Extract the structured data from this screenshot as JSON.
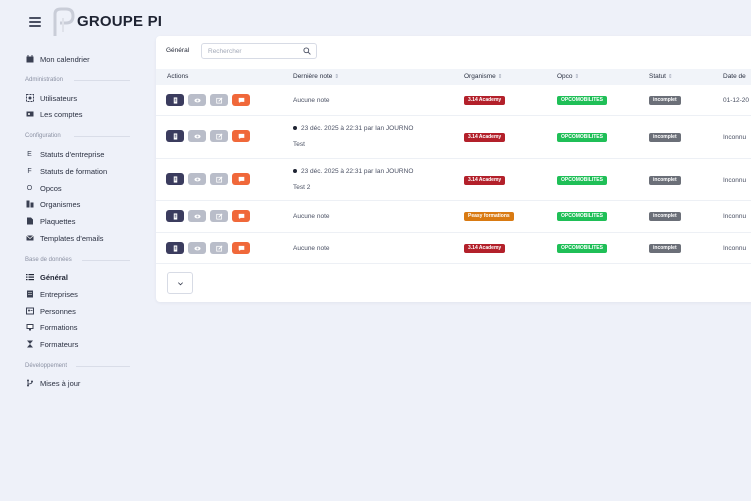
{
  "brand": {
    "name": "GROUPE PI"
  },
  "sidebar": {
    "top_items": [
      {
        "label": "Mon calendrier",
        "icon": "calendar-icon"
      }
    ],
    "sections": [
      {
        "title": "Administration",
        "items": [
          {
            "label": "Utilisateurs",
            "icon": "users-icon"
          },
          {
            "label": "Les comptes",
            "icon": "accounts-icon"
          }
        ]
      },
      {
        "title": "Configuration",
        "items": [
          {
            "label": "Statuts d'entreprise",
            "icon": "status-e-icon"
          },
          {
            "label": "Statuts de formation",
            "icon": "status-f-icon"
          },
          {
            "label": "Opcos",
            "icon": "opco-icon"
          },
          {
            "label": "Organismes",
            "icon": "organisms-icon"
          },
          {
            "label": "Plaquettes",
            "icon": "file-icon"
          },
          {
            "label": "Templates d'emails",
            "icon": "mail-icon"
          }
        ]
      },
      {
        "title": "Base de données",
        "items": [
          {
            "label": "Général",
            "icon": "list-icon"
          },
          {
            "label": "Entreprises",
            "icon": "building-icon"
          },
          {
            "label": "Personnes",
            "icon": "people-icon"
          },
          {
            "label": "Formations",
            "icon": "training-icon"
          },
          {
            "label": "Formateurs",
            "icon": "hourglass-icon"
          }
        ]
      },
      {
        "title": "Développement",
        "items": [
          {
            "label": "Mises à jour",
            "icon": "branch-icon"
          }
        ]
      }
    ]
  },
  "card": {
    "tab_label": "Général",
    "search_placeholder": "Rechercher",
    "columns": [
      "Actions",
      "Dernière note",
      "Organisme",
      "Opco",
      "Statut",
      "Date de"
    ],
    "rows": [
      {
        "note": "Aucune note",
        "note_sub": "",
        "organisme": "3.14 Academy",
        "opco": "OPCOMOBILITES",
        "statut": "incomplet",
        "date": "01-12-20"
      },
      {
        "note": "23 déc. 2025 à 22:31 par Ian JOURNO",
        "note_sub": "Test",
        "organisme": "3.14 Academy",
        "opco": "OPCOMOBILITES",
        "statut": "incomplet",
        "date": "Inconnu"
      },
      {
        "note": "23 déc. 2025 à 22:31 par Ian JOURNO",
        "note_sub": "Test 2",
        "organisme": "3.14 Academy",
        "opco": "OPCOMOBILITES",
        "statut": "incomplet",
        "date": "Inconnu"
      },
      {
        "note": "Aucune note",
        "note_sub": "",
        "organisme": "Peasy formations",
        "opco": "OPCOMOBILITES",
        "statut": "incomplet",
        "date": "Inconnu"
      },
      {
        "note": "Aucune note",
        "note_sub": "",
        "organisme": "3.14 Academy",
        "opco": "OPCOMOBILITES",
        "statut": "incomplet",
        "date": "Inconnu"
      }
    ],
    "colors": {
      "organisme_red": "#b3202a",
      "organisme_orange": "#d97a12",
      "opco_green": "#1fbf57",
      "statut_gray": "#6b6f78",
      "btn_company": "#3b3c5e",
      "btn_note": "#f0683a"
    }
  }
}
